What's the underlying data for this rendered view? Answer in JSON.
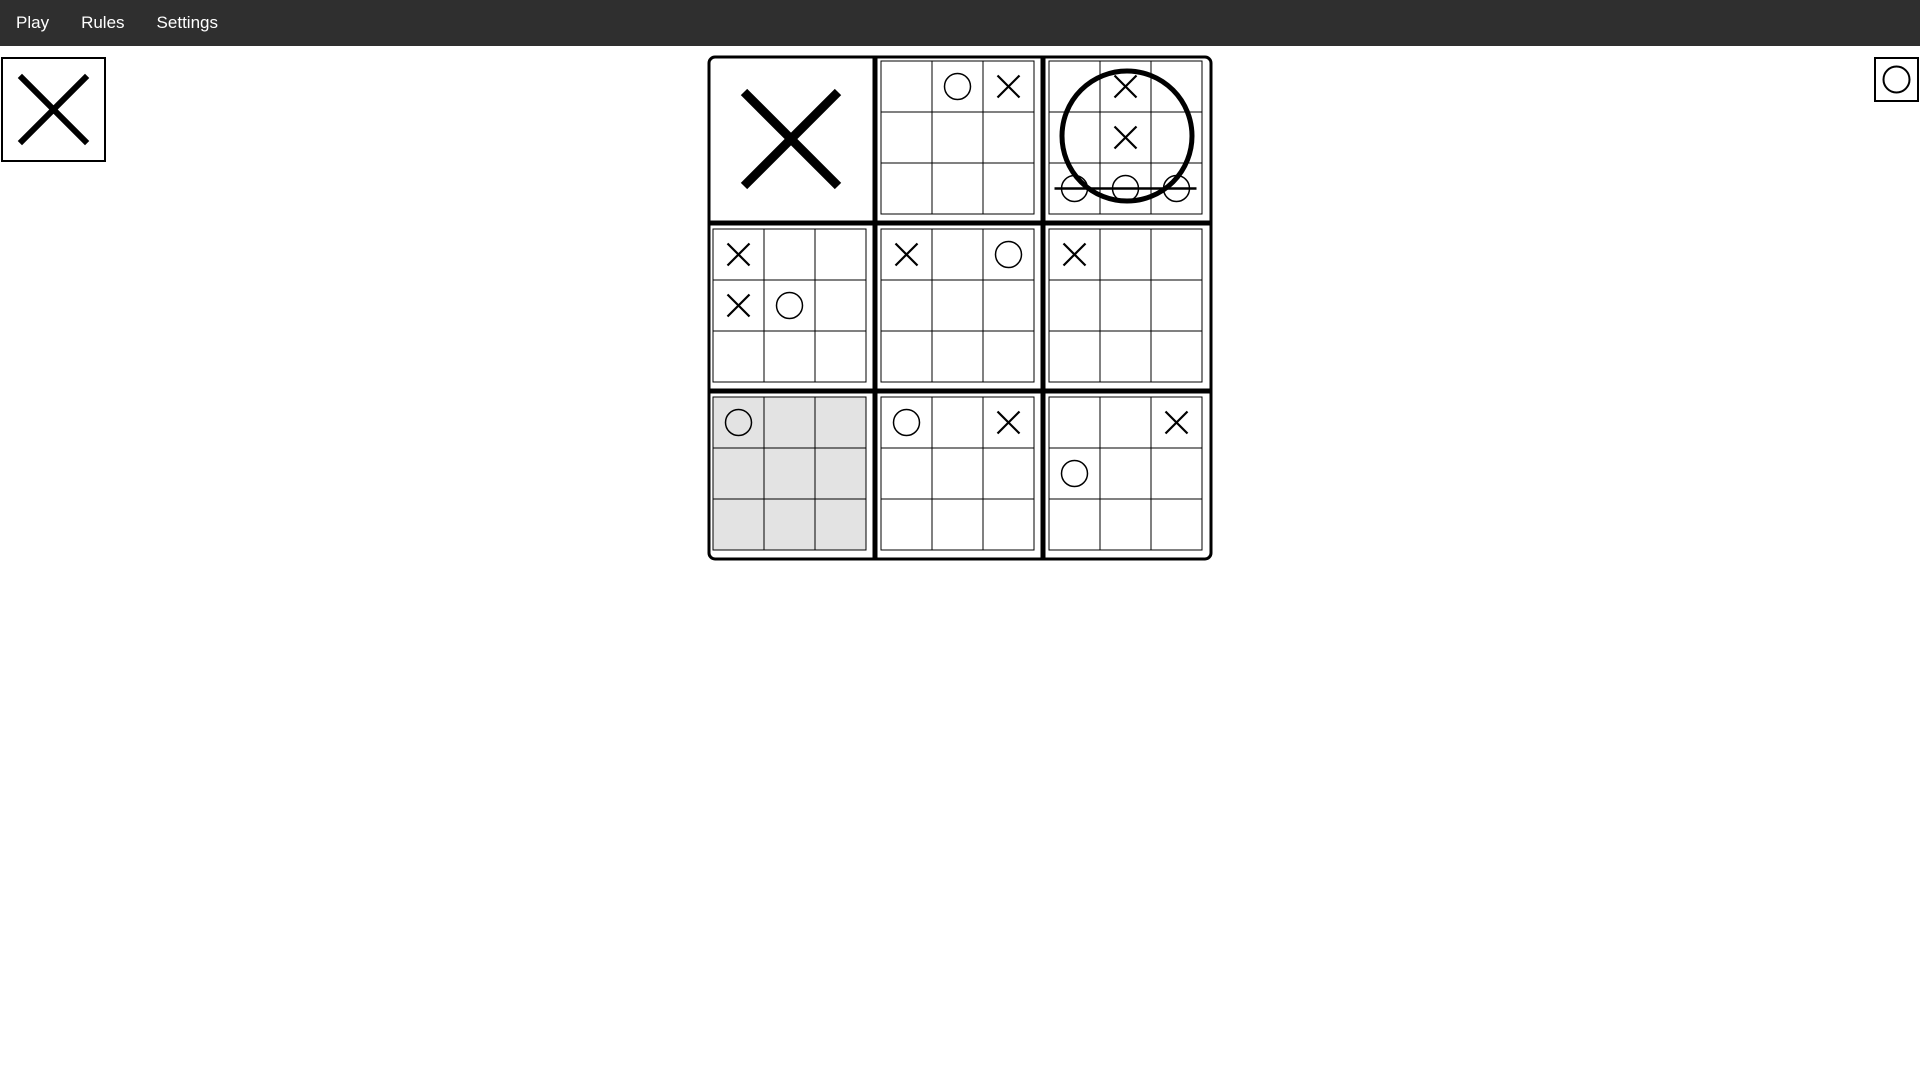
{
  "nav": {
    "items": [
      "Play",
      "Rules",
      "Settings"
    ]
  },
  "players": {
    "left_marker": "X",
    "right_marker": "O"
  },
  "colors": {
    "topbar": "#2f2f2f",
    "line": "#000000",
    "highlight": "#e3e3e3"
  },
  "board": {
    "boards": [
      {
        "winner": "X",
        "cells": [
          "",
          "",
          "",
          "",
          "",
          "",
          "",
          "",
          ""
        ],
        "highlight": false
      },
      {
        "winner": "",
        "cells": [
          "",
          "O",
          "X",
          "",
          "",
          "",
          "",
          "",
          ""
        ],
        "highlight": false
      },
      {
        "winner": "O",
        "cells": [
          "",
          "X",
          "",
          "",
          "X",
          "",
          "O",
          "O",
          "O"
        ],
        "highlight": false,
        "win_line": [
          6,
          8
        ]
      },
      {
        "winner": "",
        "cells": [
          "X",
          "",
          "",
          "X",
          "O",
          "",
          "",
          "",
          ""
        ],
        "highlight": false
      },
      {
        "winner": "",
        "cells": [
          "X",
          "",
          "O",
          "",
          "",
          "",
          "",
          "",
          ""
        ],
        "highlight": false
      },
      {
        "winner": "",
        "cells": [
          "X",
          "",
          "",
          "",
          "",
          "",
          "",
          "",
          ""
        ],
        "highlight": false
      },
      {
        "winner": "",
        "cells": [
          "O",
          "",
          "",
          "",
          "",
          "",
          "",
          "",
          ""
        ],
        "highlight": true
      },
      {
        "winner": "",
        "cells": [
          "O",
          "",
          "X",
          "",
          "",
          "",
          "",
          "",
          ""
        ],
        "highlight": false
      },
      {
        "winner": "",
        "cells": [
          "",
          "",
          "X",
          "O",
          "",
          "",
          "",
          "",
          ""
        ],
        "highlight": false
      }
    ]
  }
}
